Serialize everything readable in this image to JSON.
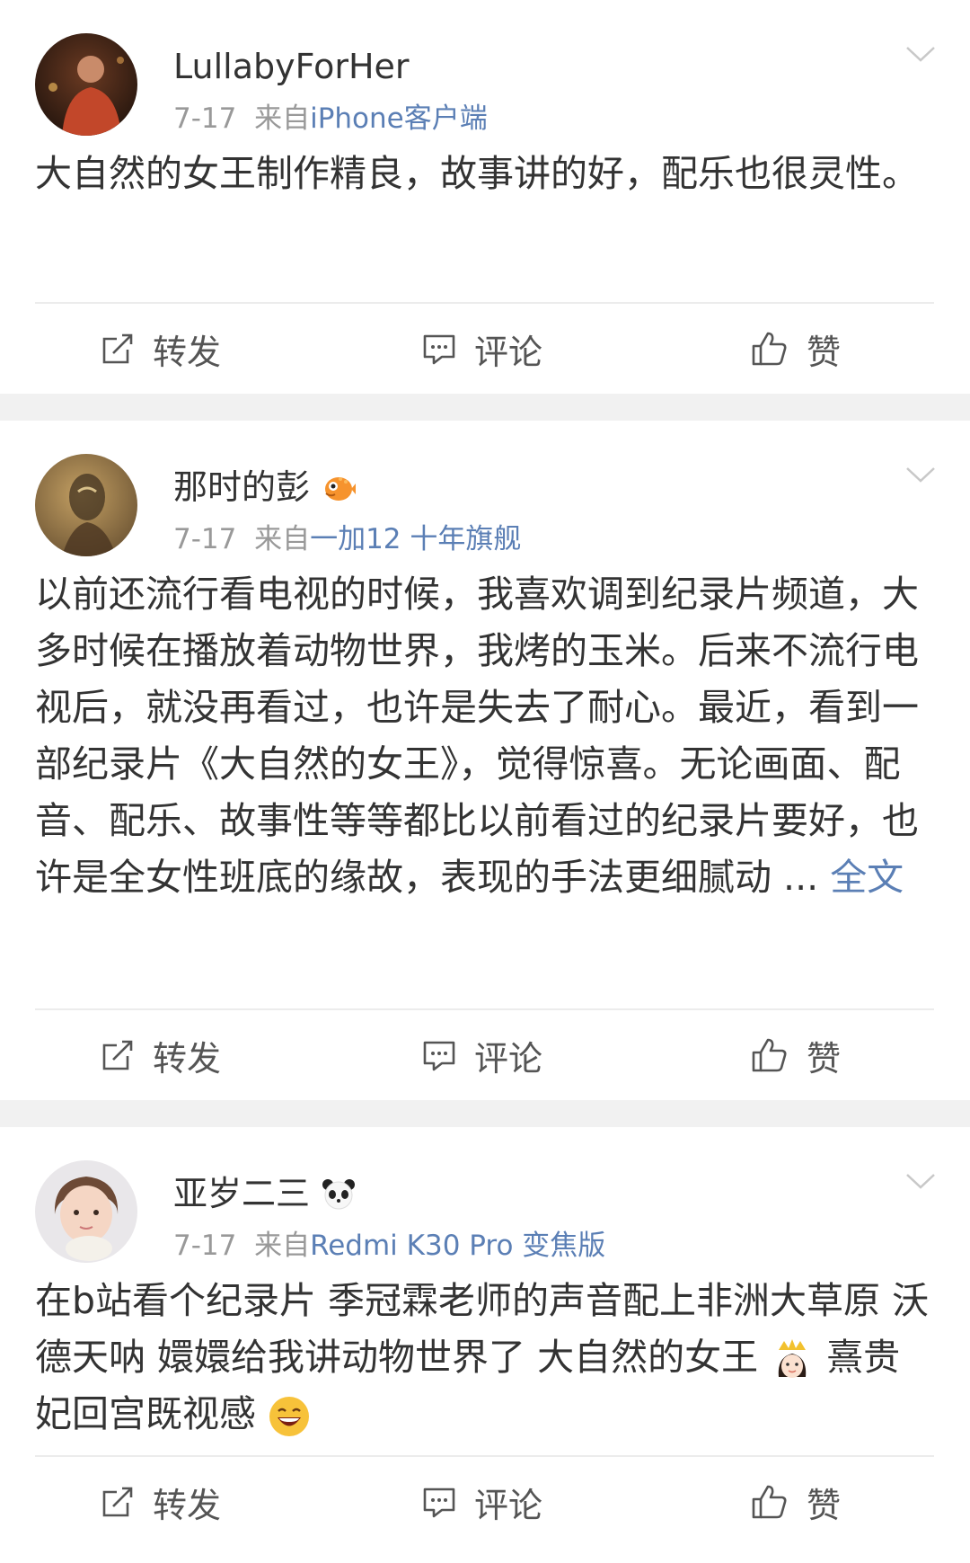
{
  "posts": [
    {
      "username": "LullabyForHer",
      "date": "7-17",
      "from_label": "来自",
      "source": "iPhone客户端",
      "content": "大自然的女王制作精良，故事讲的好，配乐也很灵性。",
      "more": "",
      "actions": {
        "repost": "转发",
        "comment": "评论",
        "like": "赞"
      }
    },
    {
      "username": "那时的彭",
      "badge_icon": "pufferfish-emoji-icon",
      "date": "7-17",
      "from_label": "来自",
      "source": "一加12 十年旗舰",
      "content": "以前还流行看电视的时候，我喜欢调到纪录片频道，大多时候在播放着动物世界，我烤的玉米。后来不流行电视后，就没再看过，也许是失去了耐心。最近，看到一部纪录片《大自然的女王》，觉得惊喜。无论画面、配音、配乐、故事性等等都比以前看过的纪录片要好，也许是全女性班底的缘故，表现的手法更细腻动 ...",
      "more": "全文",
      "actions": {
        "repost": "转发",
        "comment": "评论",
        "like": "赞"
      }
    },
    {
      "username": "亚岁二三",
      "badge_icon": "panda-emoji-icon",
      "date": "7-17",
      "from_label": "来自",
      "source": "Redmi K30 Pro 变焦版",
      "content_a": "在b站看个纪录片 季冠霖老师的声音配上非洲大草原 沃德天呐 嬛嬛给我讲动物世界了 大自然的女王",
      "content_b": "熹贵妃回宫既视感",
      "actions": {
        "repost": "转发",
        "comment": "评论",
        "like": "赞"
      }
    }
  ],
  "colors": {
    "link": "#5b7fb5",
    "meta": "#999999",
    "text": "#333333",
    "separator": "#f1f1f1"
  }
}
